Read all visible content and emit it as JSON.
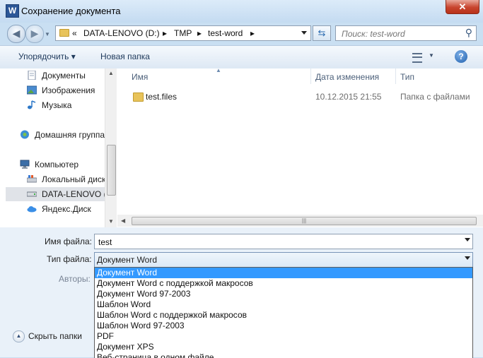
{
  "window": {
    "title": "Сохранение документа",
    "app_icon": "W",
    "close_glyph": "✕"
  },
  "address": {
    "chevron": "«",
    "segments": [
      "DATA-LENOVO (D:)",
      "TMP",
      "test-word"
    ],
    "separator": "▸"
  },
  "search": {
    "placeholder": "Поиск: test-word"
  },
  "toolbar": {
    "organize": "Упорядочить ▾",
    "new_folder": "Новая папка",
    "help": "?"
  },
  "nav": {
    "items": [
      {
        "label": "Документы"
      },
      {
        "label": "Изображения"
      },
      {
        "label": "Музыка"
      },
      {
        "label": "Домашняя группа"
      },
      {
        "label": "Компьютер"
      },
      {
        "label": "Локальный диск"
      },
      {
        "label": "DATA-LENOVO ("
      },
      {
        "label": "Яндекс.Диск"
      }
    ]
  },
  "columns": {
    "name": "Имя",
    "date": "Дата изменения",
    "type": "Тип"
  },
  "files": [
    {
      "name": "test.files",
      "date": "10.12.2015 21:55",
      "type": "Папка с файлами"
    }
  ],
  "form": {
    "filename_label": "Имя файла:",
    "filename_value": "test",
    "filetype_label": "Тип файла:",
    "filetype_value": "Документ Word",
    "authors_label": "Авторы:"
  },
  "filetype_options": [
    "Документ Word",
    "Документ Word с поддержкой макросов",
    "Документ Word 97-2003",
    "Шаблон Word",
    "Шаблон Word с поддержкой макросов",
    "Шаблон Word 97-2003",
    "PDF",
    "Документ XPS",
    "Веб-страница в одном файле"
  ],
  "footer": {
    "hide_folders": "Скрыть папки"
  },
  "colors": {
    "selection": "#3399ff",
    "titlebar": "#c4dbf1"
  }
}
